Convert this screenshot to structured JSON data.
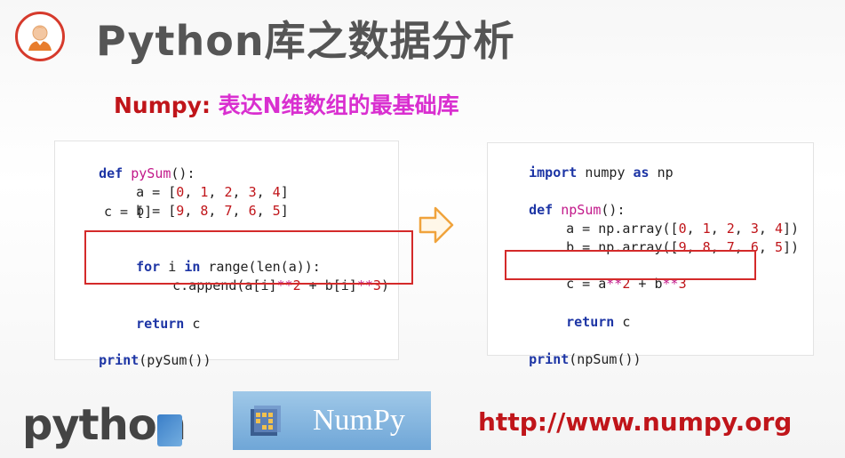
{
  "header": {
    "title": "Python库之数据分析"
  },
  "subtitle": {
    "highlight": "Numpy:",
    "rest": " 表达N维数组的最基础库"
  },
  "left_code": {
    "def_kw": "def",
    "func_name": "pySum",
    "sig_tail": "():",
    "a_line": [
      "a = [",
      "0",
      ", ",
      "1",
      ", ",
      "2",
      ", ",
      "3",
      ", ",
      "4",
      "]"
    ],
    "b_line": [
      "b = [",
      "9",
      ", ",
      "8",
      ", ",
      "7",
      ", ",
      "6",
      ", ",
      "5",
      "]"
    ],
    "c_line": "c = []",
    "for_kw": "for",
    "in_kw": "in",
    "for_mid": " i ",
    "for_tail": " range(len(a)):",
    "append_line": [
      "c.append(a[i]",
      "**",
      "2",
      " + b[i]",
      "**",
      "3",
      ")"
    ],
    "return_kw": "return",
    "return_tail": " c",
    "print_kw": "print",
    "print_tail": "(pySum())"
  },
  "right_code": {
    "import_kw": "import",
    "import_mid": " numpy ",
    "as_kw": "as",
    "import_tail": " np",
    "def_kw": "def",
    "func_name": "npSum",
    "sig_tail": "():",
    "a_line": [
      "a = np.array([",
      "0",
      ", ",
      "1",
      ", ",
      "2",
      ", ",
      "3",
      ", ",
      "4",
      "])"
    ],
    "b_line": [
      "b = np.array([",
      "9",
      ", ",
      "8",
      ", ",
      "7",
      ", ",
      "6",
      ", ",
      "5",
      "])"
    ],
    "c_line": [
      "c = a",
      "**",
      "2",
      " + b",
      "**",
      "3"
    ],
    "return_kw": "return",
    "return_tail": " c",
    "print_kw": "print",
    "print_tail": "(npSum())"
  },
  "logos": {
    "python": "python",
    "numpy": "NumPy"
  },
  "url": "http://www.numpy.org",
  "colors": {
    "title": "#555555",
    "accent_red": "#c0151a",
    "accent_magenta": "#d92fd0",
    "keyword": "#1d35a5",
    "box_border": "#d42a2a"
  },
  "icons": {
    "avatar": "person-avatar-icon",
    "arrow": "right-arrow-icon",
    "numpy_logo": "numpy-cube-icon"
  }
}
